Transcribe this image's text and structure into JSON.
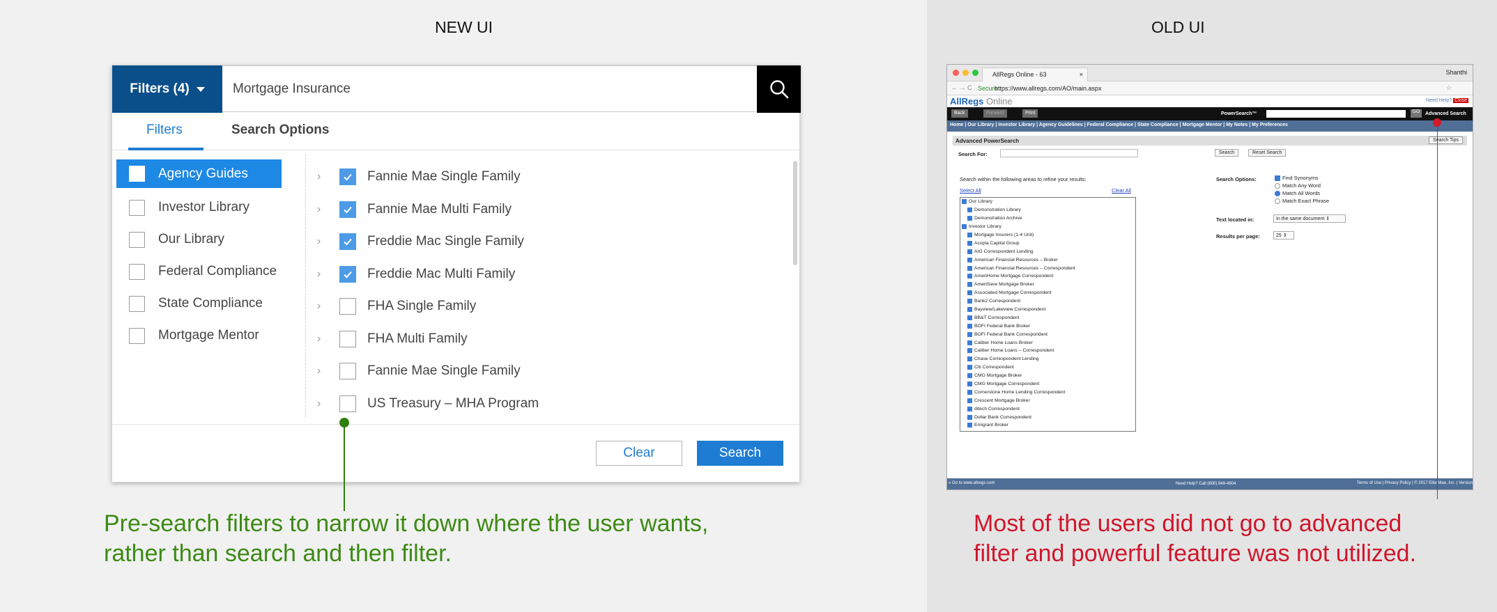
{
  "left_panel": {
    "title": "NEW UI",
    "filters_button": "Filters (4)",
    "search_value": "Mortgage Insurance",
    "tabs": [
      "Filters",
      "Search Options"
    ],
    "categories": [
      {
        "label": "Agency Guides",
        "selected": true
      },
      {
        "label": "Investor Library",
        "selected": false
      },
      {
        "label": "Our Library",
        "selected": false
      },
      {
        "label": "Federal Compliance",
        "selected": false
      },
      {
        "label": "State Compliance",
        "selected": false
      },
      {
        "label": "Mortgage Mentor",
        "selected": false
      }
    ],
    "items": [
      {
        "label": "Fannie Mae Single Family",
        "checked": true
      },
      {
        "label": "Fannie Mae Multi Family",
        "checked": true
      },
      {
        "label": "Freddie Mac Single Family",
        "checked": true
      },
      {
        "label": "Freddie Mac Multi Family",
        "checked": true
      },
      {
        "label": "FHA Single Family",
        "checked": false
      },
      {
        "label": "FHA Multi Family",
        "checked": false
      },
      {
        "label": "Fannie Mae Single Family",
        "checked": false
      },
      {
        "label": "US Treasury – MHA Program",
        "checked": false
      }
    ],
    "clear_label": "Clear",
    "search_label": "Search",
    "caption_line1": "Pre-search filters to narrow it down where the user wants,",
    "caption_line2": "rather than search and then filter.",
    "accent_color": "#1e7dd2",
    "caption_color": "#3c8a14"
  },
  "right_panel": {
    "title": "OLD UI",
    "tab_title": "AllRegs Online - 63",
    "user": "Shanthi",
    "secure": "Secure",
    "url": "https://www.allregs.com/AO/main.aspx",
    "brand": "AllRegs",
    "brand2": "Online",
    "need_help": "Need Help?",
    "close": "Close",
    "back": "Back",
    "forward": "Forward",
    "print": "Print",
    "powersearch": "PowerSearch™",
    "go": "GO",
    "advanced": "Advanced Search",
    "nav": "Home | Our Library | Investor Library | Agency Guidelines | Federal Compliance | State Compliance | Mortgage Mentor | My Notes | My Preferences",
    "section": "Advanced PowerSearch",
    "search_tips": "Search Tips",
    "search_for": "Search For:",
    "search_btn": "Search",
    "reset_btn": "Reset Search",
    "within": "Search within the following areas to refine your results:",
    "select_all": "Select All",
    "clear_all": "Clear All",
    "tree": [
      {
        "label": "Our Library",
        "indent": 0
      },
      {
        "label": "Demonstration Library",
        "indent": 1
      },
      {
        "label": "Demonstration Archive",
        "indent": 1
      },
      {
        "label": "Investor Library",
        "indent": 0
      },
      {
        "label": "Mortgage Insurers (1-4 Unit)",
        "indent": 1
      },
      {
        "label": "Acopia Capital Group",
        "indent": 1
      },
      {
        "label": "AIG Correspondent Lending",
        "indent": 1
      },
      {
        "label": "American Financial Resources – Broker",
        "indent": 1
      },
      {
        "label": "American Financial Resources – Correspondent",
        "indent": 1
      },
      {
        "label": "AmeriHome Mortgage Correspondent",
        "indent": 1
      },
      {
        "label": "AmeriSave Mortgage Broker",
        "indent": 1
      },
      {
        "label": "Associated Mortgage Correspondent",
        "indent": 1
      },
      {
        "label": "Bank2 Correspondent",
        "indent": 1
      },
      {
        "label": "Bayview/Lakeview Correspondent",
        "indent": 1
      },
      {
        "label": "BB&T Correspondent",
        "indent": 1
      },
      {
        "label": "BOFI Federal Bank Broker",
        "indent": 1
      },
      {
        "label": "BOFI Federal Bank Correspondent",
        "indent": 1
      },
      {
        "label": "Caliber Home Loans Broker",
        "indent": 1
      },
      {
        "label": "Caliber Home Loans – Correspondent",
        "indent": 1
      },
      {
        "label": "Chase Correspondent Lending",
        "indent": 1
      },
      {
        "label": "Citi Correspondent",
        "indent": 1
      },
      {
        "label": "CMG Mortgage Broker",
        "indent": 1
      },
      {
        "label": "CMG Mortgage Correspondent",
        "indent": 1
      },
      {
        "label": "Cornerstone Home Lending Correspondent",
        "indent": 1
      },
      {
        "label": "Crescent Mortgage Broker",
        "indent": 1
      },
      {
        "label": "ditech Correspondent",
        "indent": 1
      },
      {
        "label": "Dollar Bank Correspondent",
        "indent": 1
      },
      {
        "label": "Emigrant Broker",
        "indent": 1
      }
    ],
    "search_options": "Search Options:",
    "options": [
      {
        "label": "Find Synonyms",
        "kind": "check",
        "on": true
      },
      {
        "label": "Match Any Word",
        "kind": "radio",
        "on": false
      },
      {
        "label": "Match All Words",
        "kind": "radio",
        "on": true
      },
      {
        "label": "Match Exact Phrase",
        "kind": "radio",
        "on": false
      }
    ],
    "text_located": "Text located in:",
    "text_located_value": "In the same document",
    "results_per_page": "Results per page:",
    "results_value": "25",
    "footer_left": "« Go to www.allregs.com",
    "footer_mid": "Need Help? Call (800) 848-4904",
    "footer_right": "Terms of Use | Privacy Policy | © 2017 Ellie Mae, Inc. | Version",
    "caption_line1": "Most of the users did not go to advanced",
    "caption_line2": "filter and powerful feature was not utilized.",
    "caption_color": "#d0162c"
  }
}
